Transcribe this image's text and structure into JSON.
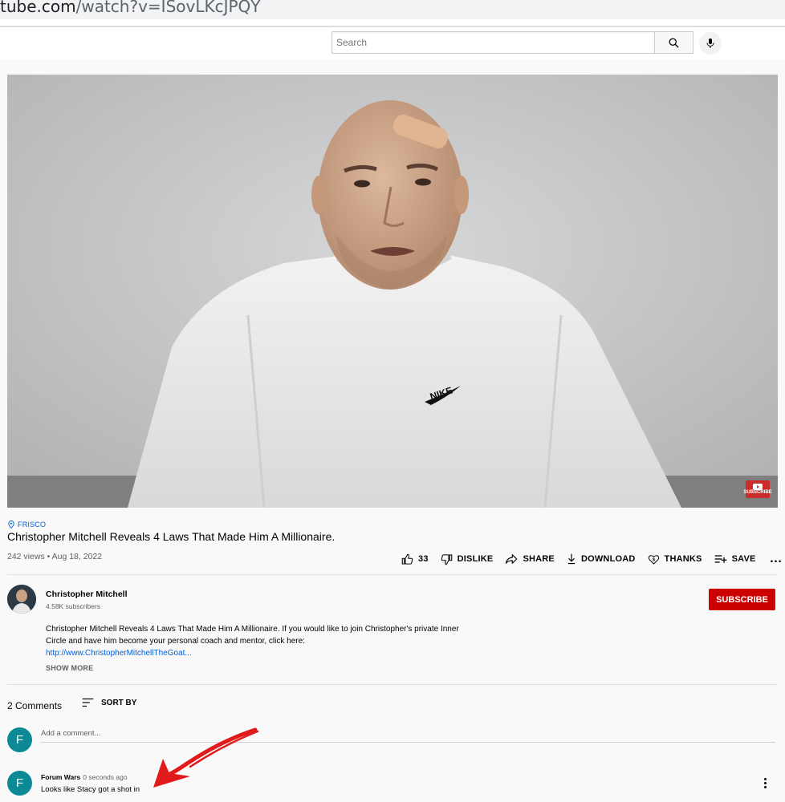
{
  "browser": {
    "url_host": "tube.com",
    "url_path": "/watch?v=ISovLKcJPQY"
  },
  "masthead": {
    "search_placeholder": "Search",
    "search_icon": "search-icon",
    "mic_icon": "microphone-icon"
  },
  "player": {
    "watermark_text": "SUBSCRIBE",
    "subject": "man in white sweatshirt with bandage on head, gray wall background"
  },
  "video": {
    "location": "FRISCO",
    "title": "Christopher Mitchell Reveals 4 Laws That Made Him A Millionaire.",
    "meta": "242 views • Aug 18, 2022"
  },
  "actions": {
    "likes": "33",
    "dislike": "DISLIKE",
    "share": "SHARE",
    "download": "DOWNLOAD",
    "thanks": "THANKS",
    "save": "SAVE",
    "more": "…"
  },
  "channel": {
    "name": "Christopher Mitchell",
    "subscribers": "4.58K subscribers",
    "subscribe_label": "SUBSCRIBE",
    "subscribe_color": "#cc0000"
  },
  "description": {
    "text": "Christopher Mitchell Reveals 4 Laws That Made Him A Millionaire. If you would like to join Christopher's private Inner Circle and have him become your personal coach and mentor, click here:",
    "link": "http://www.ChristopherMitchellTheGoat...",
    "show_more": "SHOW MORE"
  },
  "comments": {
    "count_label": "2 Comments",
    "sort_label": "SORT BY",
    "add_placeholder": "Add a comment...",
    "viewer_initial": "F",
    "items": [
      {
        "initial": "F",
        "author": "Forum Wars",
        "time": "0 seconds ago",
        "text": "Looks like Stacy got a shot in"
      }
    ],
    "avatar_color": "#0b8a95"
  },
  "annotation": {
    "arrow_color": "#e11b1b"
  }
}
